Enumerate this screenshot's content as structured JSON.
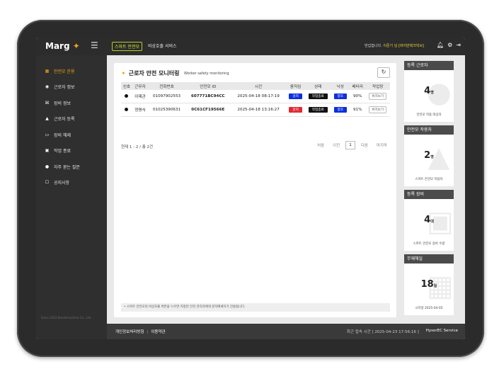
{
  "topbar": {
    "logo": "Marg",
    "mode_badge": "스마트 안전모",
    "emergency": "비상호출 서비스",
    "welcome_prefix": "반갑습니다.",
    "welcome_user": "이준기 님 [바이만테크빅브]",
    "icons": [
      "bell-icon",
      "gear-icon",
      "logout-icon"
    ]
  },
  "sidebar": {
    "items": [
      {
        "label": "안전모 운용",
        "icon": "grid-icon",
        "active": true
      },
      {
        "label": "근로자 정보",
        "icon": "user-icon"
      },
      {
        "label": "장비 정보",
        "icon": "device-icon"
      },
      {
        "label": "근로자 등록",
        "icon": "helmet-icon"
      },
      {
        "label": "장비 해제",
        "icon": "card-icon"
      },
      {
        "label": "작업 종료",
        "icon": "calendar-icon"
      },
      {
        "label": "자주 묻는 질문",
        "icon": "chat-icon"
      },
      {
        "label": "공지사항",
        "icon": "note-icon"
      }
    ],
    "copyright": "Since 2023 Bandamachine Co., Ltd."
  },
  "main": {
    "title": "근로자 안전 모니터링",
    "subtitle": "Worker safety monitoring",
    "columns": [
      "신호",
      "근무자",
      "전화번호",
      "안전모 ID",
      "시간",
      "움직임",
      "상태",
      "낙상",
      "배터리",
      "작업장"
    ],
    "rows": [
      {
        "name": "이재관",
        "phone": "01097902553",
        "device_id": "607771BC94CC",
        "time": "2025-04-18 08:17:19",
        "movement": "감지",
        "status": "작업종료",
        "fall": "양호",
        "battery": "90%",
        "location": "위치보기"
      },
      {
        "name": "정명식",
        "phone": "01025390631",
        "device_id": "0C61CF19566E",
        "time": "2025-04-18 13:16:27",
        "movement": "감지",
        "status": "작업종료",
        "fall": "양호",
        "battery": "91%",
        "location": "위치보기"
      }
    ],
    "page_info": "현재 1 - 2 / 총 2건",
    "pager": {
      "first": "처음",
      "prev": "이전",
      "current": "1",
      "next": "다음",
      "last": "마지막"
    },
    "notice": "• 스마트 안전모의 비상호출 버튼을 누르면 지정된 안전 관리자에게 문자메세지가 전송됩니다."
  },
  "cards": [
    {
      "head": "등록 근로자",
      "value": "4",
      "unit": "명",
      "label": "안전모 작용 대상자"
    },
    {
      "head": "안전모 작용자",
      "value": "2",
      "unit": "명",
      "label": "스마트 안전모 작용자"
    },
    {
      "head": "등록 장비",
      "value": "4",
      "unit": "대",
      "label": "스마트 안전모 장비 수량"
    },
    {
      "head": "무재해일",
      "value": "18",
      "unit": "일",
      "label": "시작일 2025-04-05"
    }
  ],
  "footer": {
    "privacy": "개인정보처리방침",
    "terms": "이용약관",
    "last_access": "최근 접속 시간 [ 2025-04-23 17:56:16 ]",
    "brand": "HysorEC Service"
  },
  "colors": {
    "accent": "#f2a516",
    "blue_pill": "#0c2fe0",
    "red_pill": "#e02a35",
    "sidebar": "#2f2f2f"
  }
}
